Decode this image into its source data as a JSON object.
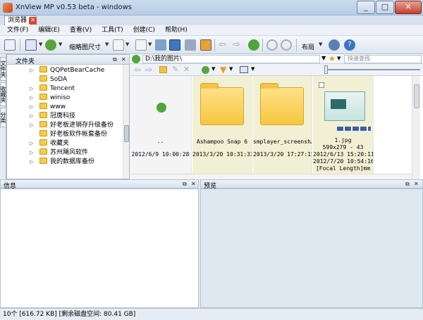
{
  "window": {
    "title": "XnView MP v0.53 beta - windows"
  },
  "tabs": [
    {
      "label": "浏览器"
    }
  ],
  "menu": [
    "文件(F)",
    "编辑(E)",
    "查看(V)",
    "工具(T)",
    "创建(C)",
    "帮助(H)"
  ],
  "toolbar": {
    "thumb_size_label": "缩略图尺寸",
    "layout_label": "布局"
  },
  "folders_panel": {
    "title": "文件夹",
    "items": [
      {
        "label": "QQPetBearCache",
        "expandable": true
      },
      {
        "label": "SoDA",
        "expandable": false
      },
      {
        "label": "Tencent",
        "expandable": true
      },
      {
        "label": "winiso",
        "expandable": true
      },
      {
        "label": "www",
        "expandable": true
      },
      {
        "label": "冠唐科技",
        "expandable": true
      },
      {
        "label": "好老板进销存升级备份",
        "expandable": true
      },
      {
        "label": "好老板软件帐套备份",
        "expandable": false
      },
      {
        "label": "收藏夹",
        "expandable": true
      },
      {
        "label": "苏州飓风软件",
        "expandable": true
      },
      {
        "label": "我的数据库备份",
        "expandable": true
      }
    ]
  },
  "side_tabs": [
    "文件夹",
    "收藏夹",
    "分类"
  ],
  "address": {
    "path": "D:\\我的图片\\",
    "search_placeholder": "快速查找"
  },
  "thumbnails": [
    {
      "name": "..",
      "date": "2012/6/9 10:00:28",
      "kind": "parent"
    },
    {
      "name": "Ashampoo Snap 6",
      "date": "2013/3/20 10:31:33",
      "kind": "folder"
    },
    {
      "name": "smplayer_screensh…",
      "date": "2013/3/20 17:27:15",
      "kind": "folder"
    },
    {
      "name": "1.jpg",
      "dims": "599x279 - 43",
      "date": "2012/6/13 15:20:11",
      "date2": "2012/7/20 10:54:16",
      "extra": "[Focal Length]mm",
      "kind": "image"
    }
  ],
  "info_pane": {
    "title": "信息"
  },
  "preview_pane": {
    "title": "预览"
  },
  "status": {
    "text": "10个 [616.72 KB] [剩余磁盘空间: 80.41 GB]"
  },
  "colors": {
    "folder": "#f6c63d",
    "titlebar": "#c9dcef",
    "selected_thumb": "#f2f0d4"
  }
}
